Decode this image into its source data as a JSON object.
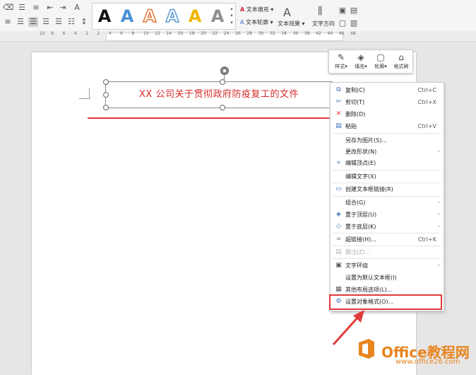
{
  "toolbar": {
    "text_fill": "文本填充",
    "text_outline": "文本轮廓",
    "text_effect": "文本效果",
    "text_direction": "文字方向",
    "style_letter": "A"
  },
  "ruler": {
    "numbers": [
      "10",
      "8",
      "6",
      "4",
      "2",
      "2",
      "4",
      "6",
      "8",
      "10",
      "12",
      "14",
      "16",
      "18",
      "20",
      "22",
      "24",
      "26",
      "28",
      "30",
      "32",
      "34",
      "36",
      "38",
      "42",
      "44",
      "46",
      "48"
    ]
  },
  "document": {
    "textbox_text": "XX 公司关于贯彻政府防疫复工的文件"
  },
  "mini_toolbar": {
    "items": [
      {
        "label": "样式",
        "icon": "brush-icon"
      },
      {
        "label": "填充",
        "icon": "fill-bucket-icon"
      },
      {
        "label": "轮廓",
        "icon": "outline-icon"
      },
      {
        "label": "格式刷",
        "icon": "format-painter-icon"
      }
    ]
  },
  "context_menu": {
    "items": [
      {
        "label": "复制(C)",
        "shortcut": "Ctrl+C"
      },
      {
        "label": "剪切(T)",
        "shortcut": "Ctrl+X"
      },
      {
        "label": "删除(D)",
        "shortcut": ""
      },
      {
        "label": "粘贴",
        "shortcut": "Ctrl+V"
      },
      {
        "label": "另存为图片(S)...",
        "shortcut": ""
      },
      {
        "label": "更改形状(N)",
        "shortcut": ""
      },
      {
        "label": "编辑顶点(E)",
        "shortcut": ""
      },
      {
        "label": "编辑文字(X)",
        "shortcut": ""
      },
      {
        "label": "创建文本框链接(R)",
        "shortcut": ""
      },
      {
        "label": "组合(G)",
        "shortcut": ""
      },
      {
        "label": "置于顶层(U)",
        "shortcut": ""
      },
      {
        "label": "置于底层(K)",
        "shortcut": ""
      },
      {
        "label": "超链接(H)...",
        "shortcut": "Ctrl+K"
      },
      {
        "label": "题注(Z)...",
        "shortcut": ""
      },
      {
        "label": "文字环绕",
        "shortcut": ""
      },
      {
        "label": "设置为默认文本框(I)",
        "shortcut": ""
      },
      {
        "label": "其他布局选项(L)...",
        "shortcut": ""
      },
      {
        "label": "设置对象格式(O)...",
        "shortcut": ""
      }
    ]
  },
  "watermark": {
    "brand": "Office教程网",
    "url": "www.office26.com"
  },
  "colors": {
    "accent_red": "#e23b3b",
    "title_red": "#d42a2a",
    "brand_orange": "#e8841e"
  }
}
